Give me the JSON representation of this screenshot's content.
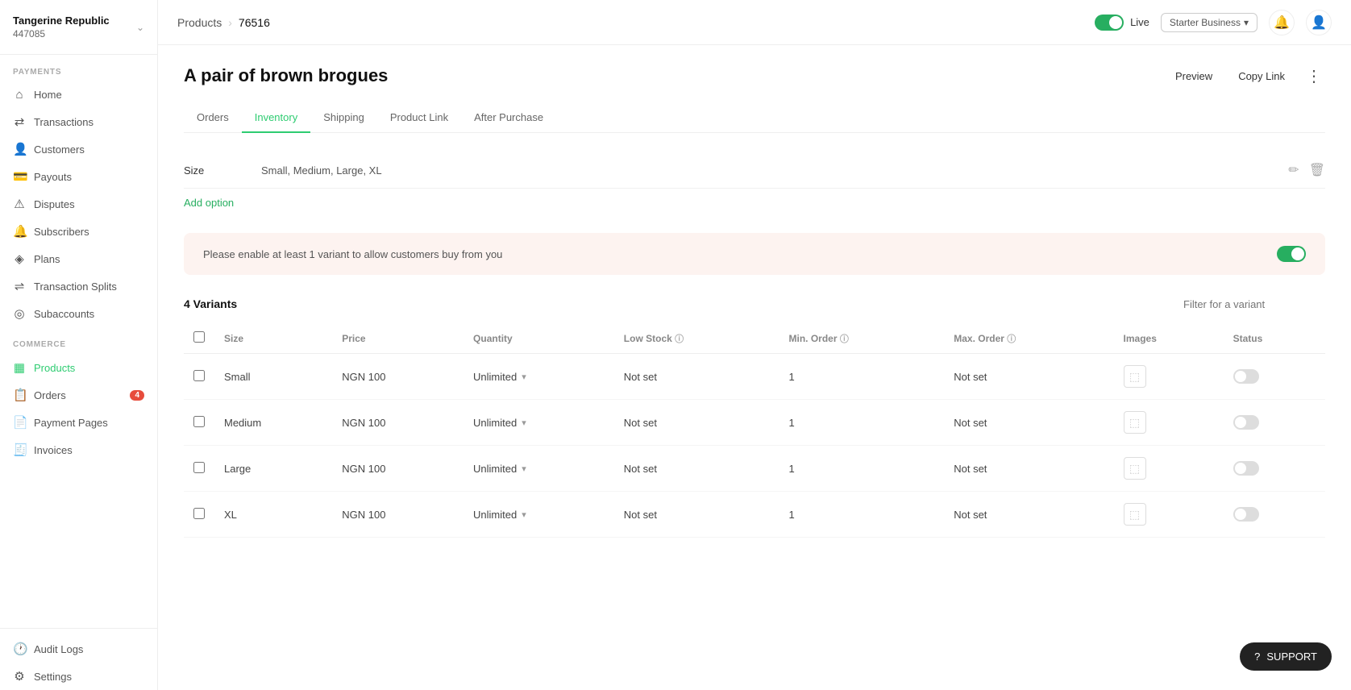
{
  "brand": {
    "name": "Tangerine Republic",
    "id": "447085",
    "chevron": "⌄"
  },
  "sidebar": {
    "payments_label": "PAYMENTS",
    "commerce_label": "COMMERCE",
    "items_payments": [
      {
        "id": "home",
        "label": "Home",
        "icon": "⌂"
      },
      {
        "id": "transactions",
        "label": "Transactions",
        "icon": "↔"
      },
      {
        "id": "customers",
        "label": "Customers",
        "icon": "👤"
      },
      {
        "id": "payouts",
        "label": "Payouts",
        "icon": "💳"
      },
      {
        "id": "disputes",
        "label": "Disputes",
        "icon": "⚠"
      },
      {
        "id": "subscribers",
        "label": "Subscribers",
        "icon": "🔔"
      },
      {
        "id": "plans",
        "label": "Plans",
        "icon": "◈"
      },
      {
        "id": "transaction-splits",
        "label": "Transaction Splits",
        "icon": "⇌"
      },
      {
        "id": "subaccounts",
        "label": "Subaccounts",
        "icon": "◎"
      }
    ],
    "items_commerce": [
      {
        "id": "products",
        "label": "Products",
        "icon": "▦",
        "active": true
      },
      {
        "id": "orders",
        "label": "Orders",
        "icon": "📋",
        "badge": "4"
      },
      {
        "id": "payment-pages",
        "label": "Payment Pages",
        "icon": "📄"
      },
      {
        "id": "invoices",
        "label": "Invoices",
        "icon": "🧾"
      }
    ],
    "items_bottom": [
      {
        "id": "audit-logs",
        "label": "Audit Logs",
        "icon": "🕐"
      },
      {
        "id": "settings",
        "label": "Settings",
        "icon": "⚙"
      }
    ]
  },
  "topbar": {
    "breadcrumb_root": "Products",
    "breadcrumb_current": "76516",
    "live_label": "Live",
    "plan_label": "Starter Business",
    "plan_chevron": "▾"
  },
  "page": {
    "title": "A pair of brown brogues",
    "preview_label": "Preview",
    "copy_link_label": "Copy Link",
    "more_icon": "⋮"
  },
  "tabs": [
    {
      "id": "orders",
      "label": "Orders",
      "active": false
    },
    {
      "id": "inventory",
      "label": "Inventory",
      "active": true
    },
    {
      "id": "shipping",
      "label": "Shipping",
      "active": false
    },
    {
      "id": "product-link",
      "label": "Product Link",
      "active": false
    },
    {
      "id": "after-purchase",
      "label": "After Purchase",
      "active": false
    }
  ],
  "options": {
    "rows": [
      {
        "label": "Size",
        "values": "Small, Medium, Large, XL"
      }
    ],
    "add_label": "Add option"
  },
  "banner": {
    "text": "Please enable at least 1 variant to allow customers buy from you",
    "toggle_on": true
  },
  "variants": {
    "count_label": "4 Variants",
    "filter_placeholder": "Filter for a variant",
    "columns": [
      {
        "id": "size",
        "label": "Size"
      },
      {
        "id": "price",
        "label": "Price"
      },
      {
        "id": "quantity",
        "label": "Quantity"
      },
      {
        "id": "low-stock",
        "label": "Low Stock"
      },
      {
        "id": "min-order",
        "label": "Min. Order"
      },
      {
        "id": "max-order",
        "label": "Max. Order"
      },
      {
        "id": "images",
        "label": "Images"
      },
      {
        "id": "status",
        "label": "Status"
      }
    ],
    "rows": [
      {
        "size": "Small",
        "price": "NGN  100",
        "quantity": "Unlimited",
        "low_stock": "Not set",
        "min_order": "1",
        "max_order": "Not set"
      },
      {
        "size": "Medium",
        "price": "NGN  100",
        "quantity": "Unlimited",
        "low_stock": "Not set",
        "min_order": "1",
        "max_order": "Not set"
      },
      {
        "size": "Large",
        "price": "NGN  100",
        "quantity": "Unlimited",
        "low_stock": "Not set",
        "min_order": "1",
        "max_order": "Not set"
      },
      {
        "size": "XL",
        "price": "NGN  100",
        "quantity": "Unlimited",
        "low_stock": "Not set",
        "min_order": "1",
        "max_order": "Not set"
      }
    ]
  },
  "support": {
    "label": "SUPPORT",
    "icon": "?"
  }
}
